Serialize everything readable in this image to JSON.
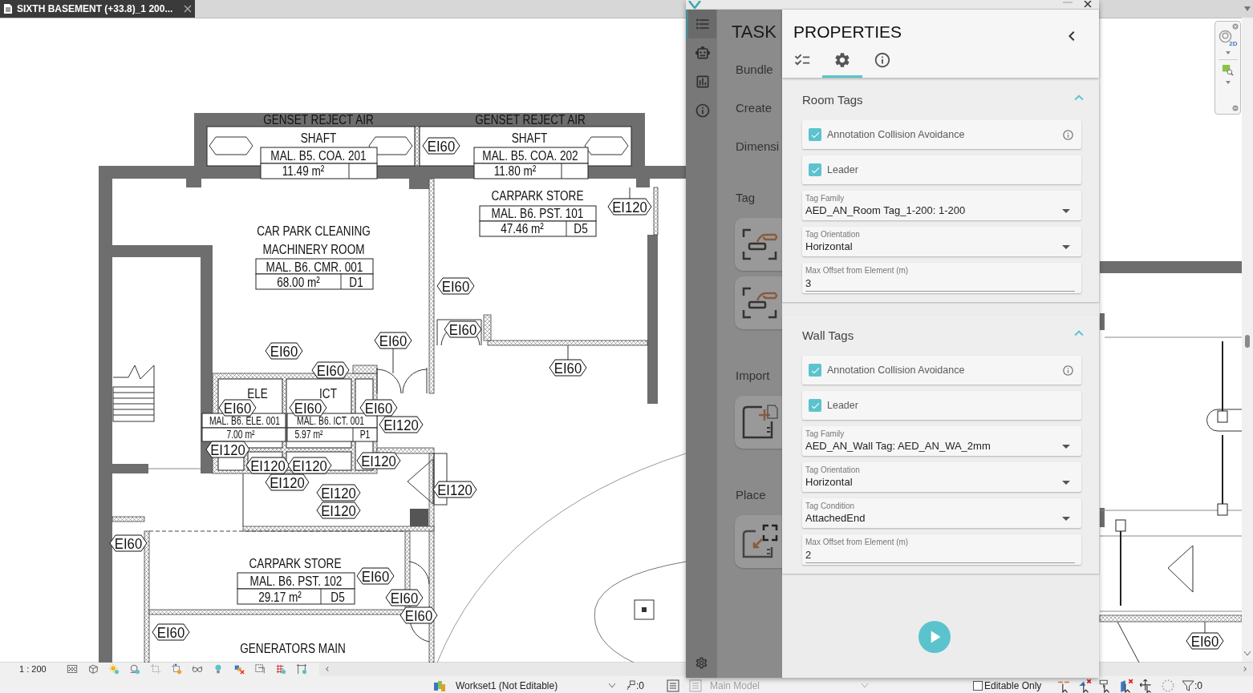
{
  "document_tab": {
    "title": "SIXTH BASEMENT (+33.8)_1 200...",
    "selected": true
  },
  "floor_plan": {
    "labels": [
      "GENSET REJECT AIR",
      "GENSET REJECT AIR",
      "SHAFT",
      "SHAFT",
      "MAL. B5. COA. 201",
      "MAL. B5. COA. 202",
      "11.49 m²",
      "11.80 m²",
      "CARPARK STORE",
      "MAL. B6. PST. 101",
      "CAR PARK CLEANING",
      "47.46 m²",
      "D5",
      "MACHINERY ROOM",
      "MAL. B6. CMR. 001",
      "68.00 m²",
      "D1",
      "ELE",
      "ICT",
      "MAL. B6. ELE. 001",
      "MAL. B6. ICT. 001",
      "7.00 m²",
      "5.97 m²",
      "P1",
      "CARPARK STORE",
      "MAL. B6. PST. 102",
      "29.17 m²",
      "D5",
      "GENERATORS MAIN"
    ],
    "fire_tags": [
      "EI60",
      "EI120",
      "EI60",
      "EI60",
      "EI60",
      "EI60",
      "EI60",
      "EI60",
      "EI60",
      "EI60",
      "EI60",
      "EI120",
      "EI120",
      "EI120",
      "EI120",
      "EI120",
      "EI120",
      "EI120",
      "EI120",
      "EI120",
      "EI60",
      "EI60",
      "EI60",
      "EI60",
      "EI60",
      "EI60"
    ]
  },
  "navigation_bar": {
    "wheel_label": "2D"
  },
  "view_bar": {
    "scale": "1 : 200"
  },
  "status_bar": {
    "workset": "Workset1 (Not Editable)",
    "element_count": ":0",
    "model": {
      "value": "Main Model",
      "disabled": true
    },
    "editable_only": {
      "label": "Editable Only",
      "checked": false
    },
    "filter_count": ":0"
  },
  "plugin": {
    "rail": [
      {
        "selected": true
      },
      {
        "selected": false
      },
      {
        "selected": false
      },
      {
        "selected": false
      }
    ],
    "tasks": {
      "title": "TASK",
      "items": [
        {
          "kind": "label",
          "text": "Bundle"
        },
        {
          "kind": "label",
          "text": "Create"
        },
        {
          "kind": "label",
          "text": "Dimensi"
        },
        {
          "kind": "label",
          "text": "Tag"
        },
        {
          "kind": "tag-card"
        },
        {
          "kind": "tag-card"
        },
        {
          "kind": "label",
          "text": "Import"
        },
        {
          "kind": "import-card"
        },
        {
          "kind": "label",
          "text": "Place"
        },
        {
          "kind": "place-card"
        }
      ]
    },
    "properties": {
      "title": "PROPERTIES",
      "tabs": [
        {
          "selected": false
        },
        {
          "selected": true
        },
        {
          "selected": false
        }
      ],
      "sections": [
        {
          "title": "Room Tags",
          "expanded": true,
          "fields": [
            {
              "kind": "checkbox",
              "label": "Annotation Collision Avoidance",
              "checked": true,
              "info": true
            },
            {
              "kind": "checkbox",
              "label": "Leader",
              "checked": true
            },
            {
              "kind": "select",
              "label": "Tag Family",
              "value": "AED_AN_Room Tag_1-200: 1-200"
            },
            {
              "kind": "select",
              "label": "Tag Orientation",
              "value": "Horizontal"
            },
            {
              "kind": "input",
              "label": "Max Offset from Element (m)",
              "value": "3"
            }
          ]
        },
        {
          "title": "Wall Tags",
          "expanded": true,
          "fields": [
            {
              "kind": "checkbox",
              "label": "Annotation Collision Avoidance",
              "checked": true,
              "info": true
            },
            {
              "kind": "checkbox",
              "label": "Leader",
              "checked": true
            },
            {
              "kind": "select",
              "label": "Tag Family",
              "value": "AED_AN_Wall Tag: AED_AN_WA_2mm"
            },
            {
              "kind": "select",
              "label": "Tag Orientation",
              "value": "Horizontal"
            },
            {
              "kind": "select",
              "label": "Tag Condition",
              "value": "AttachedEnd"
            },
            {
              "kind": "input",
              "label": "Max Offset from Element (m)",
              "value": "2"
            }
          ]
        }
      ]
    }
  }
}
